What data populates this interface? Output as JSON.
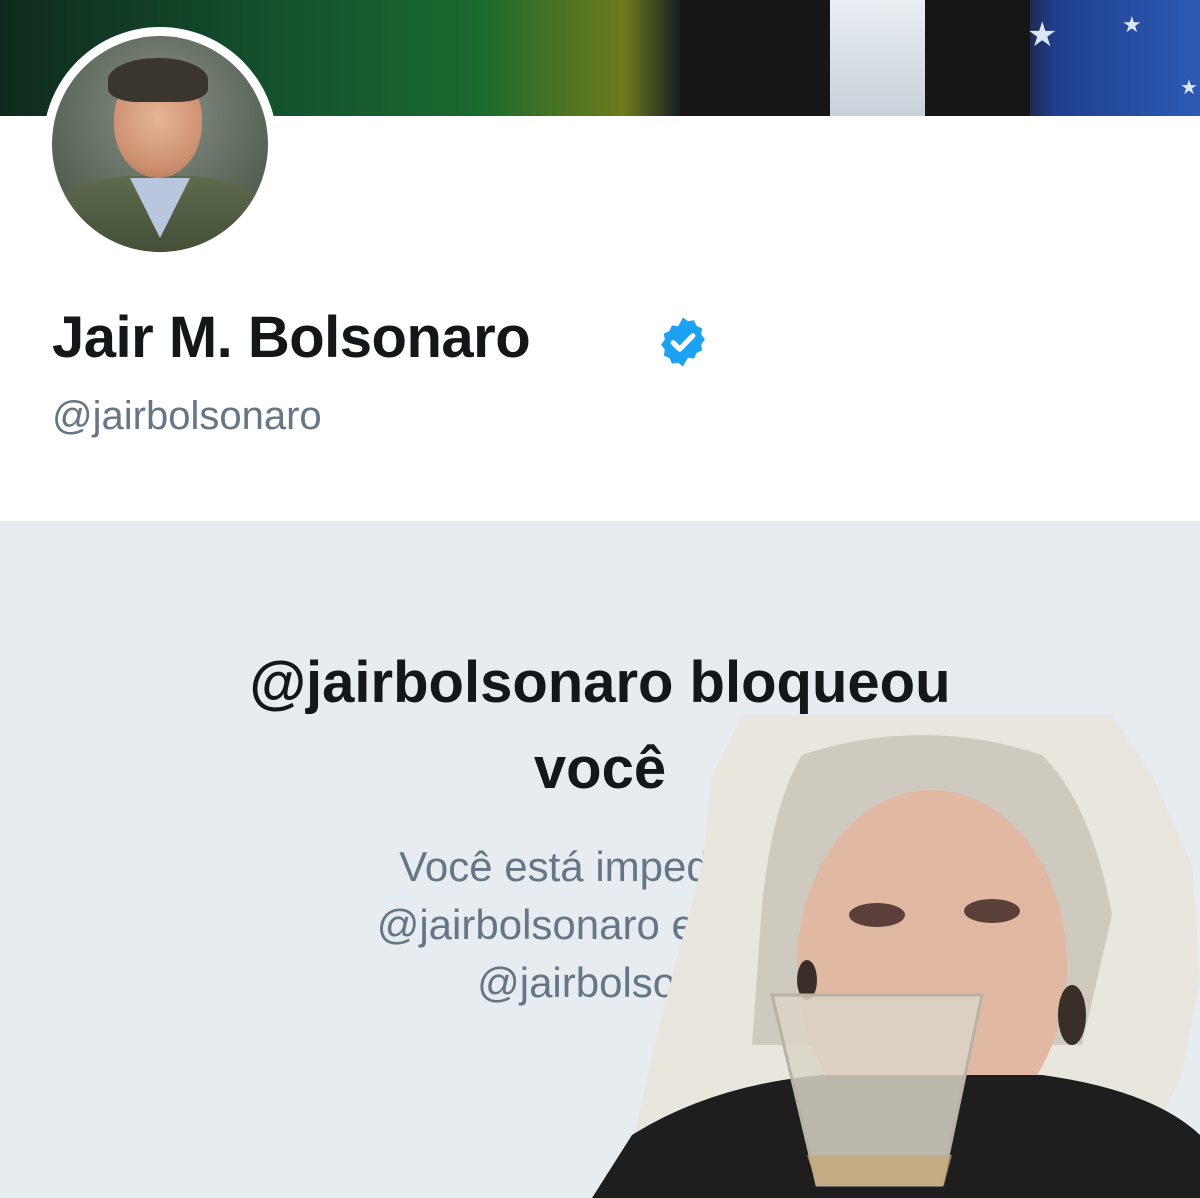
{
  "profile": {
    "display_name": "Jair M. Bolsonaro",
    "handle": "@jairbolsonaro",
    "verified": true,
    "verified_color": "#1da1f2",
    "avatar": "profile-photo"
  },
  "blocked": {
    "title_line1": "@jairbolsonaro bloqueou",
    "title_line2": "você",
    "desc_line1": "Você está impedido d",
    "desc_line2": "@jairbolsonaro e de ver",
    "desc_line3": "@jairbolsona"
  },
  "colors": {
    "text_primary": "#14171a",
    "text_secondary": "#657786",
    "panel_bg": "#e6ecf0"
  },
  "overlay": {
    "type": "meme-photo",
    "icon": "woman-drinking-champagne-image"
  }
}
